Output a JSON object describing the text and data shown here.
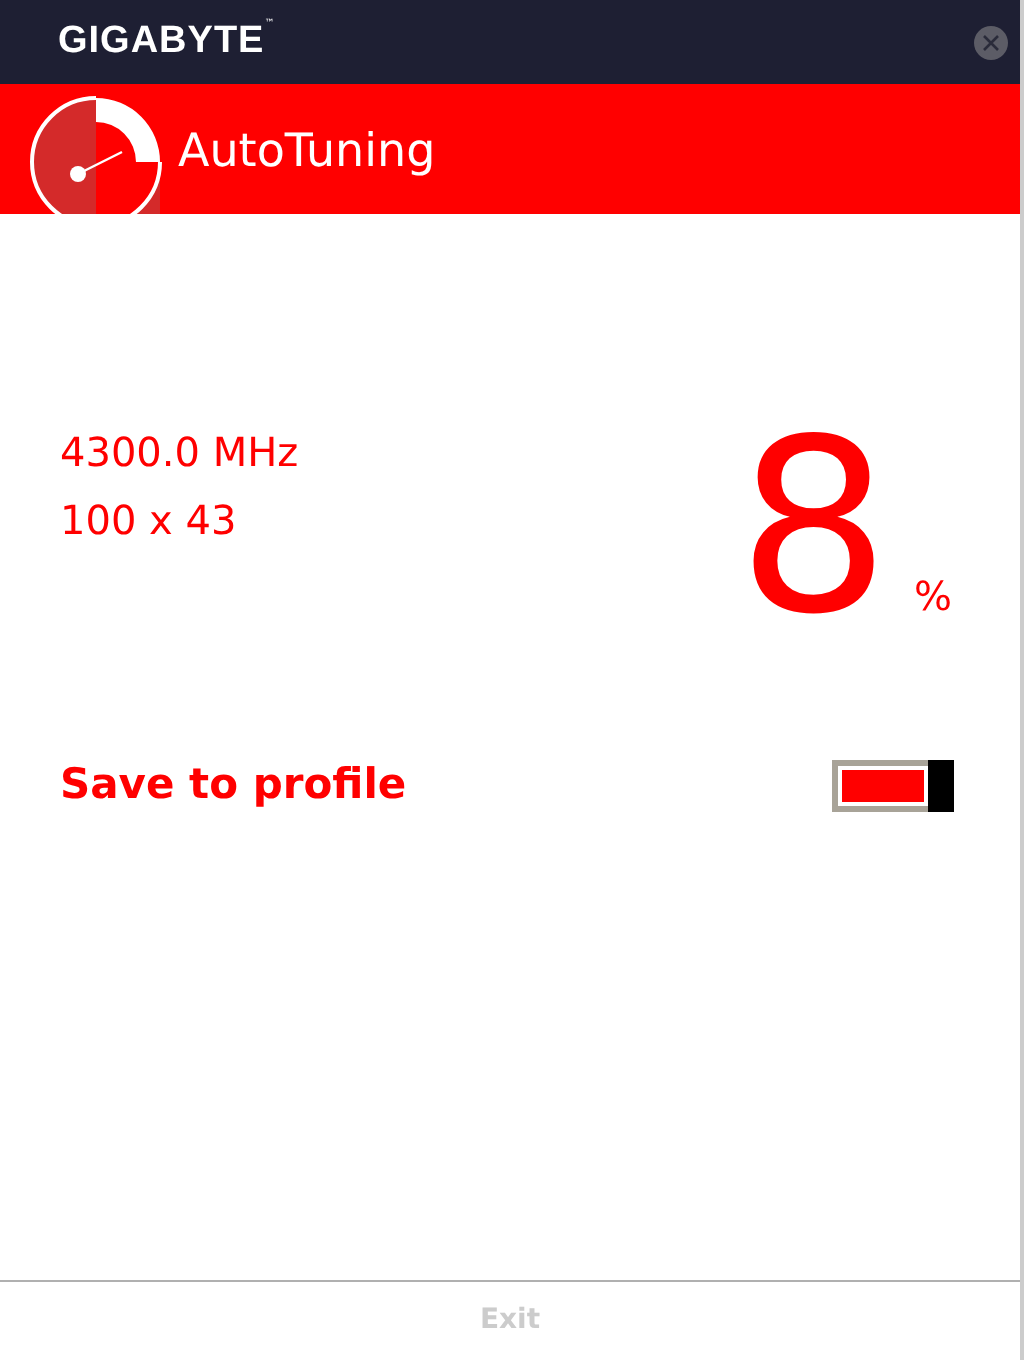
{
  "window": {
    "brand": "GIGABYTE",
    "brand_mark": "™"
  },
  "header": {
    "title": "AutoTuning"
  },
  "readings": {
    "frequency": "4300.0 MHz",
    "ratio": "100 x 43",
    "progress": "8",
    "unit": "%"
  },
  "save_to_profile": {
    "label": "Save to profile",
    "on": true
  },
  "footer": {
    "exit": {
      "label": "Exit",
      "disabled": true
    }
  }
}
